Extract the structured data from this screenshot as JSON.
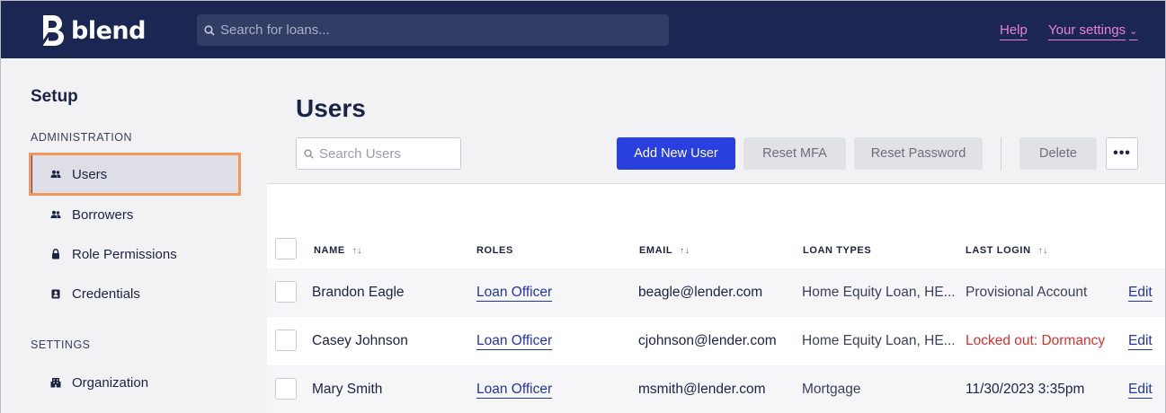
{
  "app": {
    "logo_text": "blend",
    "search_placeholder": "Search for loans...",
    "help_label": "Help",
    "settings_label": "Your settings"
  },
  "sidebar": {
    "title": "Setup",
    "sections": [
      {
        "label": "ADMINISTRATION",
        "items": [
          {
            "label": "Users",
            "icon": "users-icon",
            "active": true
          },
          {
            "label": "Borrowers",
            "icon": "people-icon"
          },
          {
            "label": "Role Permissions",
            "icon": "lock-icon"
          },
          {
            "label": "Credentials",
            "icon": "id-card-icon"
          }
        ]
      },
      {
        "label": "SETTINGS",
        "items": [
          {
            "label": "Organization",
            "icon": "building-icon"
          }
        ]
      }
    ]
  },
  "main": {
    "title": "Users",
    "search_placeholder": "Search Users",
    "buttons": {
      "add": "Add New User",
      "reset_mfa": "Reset MFA",
      "reset_password": "Reset Password",
      "delete": "Delete",
      "more": "•••"
    },
    "table": {
      "headers": {
        "name": "NAME",
        "roles": "ROLES",
        "email": "EMAIL",
        "loan_types": "LOAN TYPES",
        "last_login": "LAST LOGIN"
      },
      "rows": [
        {
          "name": "Brandon Eagle",
          "role": "Loan Officer",
          "email": "beagle@lender.com",
          "loan_types": "Home Equity Loan, HE...",
          "last_login": "Provisional Account",
          "edit": "Edit"
        },
        {
          "name": "Casey Johnson",
          "role": "Loan Officer",
          "email": "cjohnson@lender.com",
          "loan_types": "Home Equity Loan, HE...",
          "last_login": "Locked out: Dormancy",
          "edit": "Edit"
        },
        {
          "name": "Mary Smith",
          "role": "Loan Officer",
          "email": "msmith@lender.com",
          "loan_types": "Mortgage",
          "last_login": "11/30/2023 3:35pm",
          "edit": "Edit"
        }
      ]
    }
  },
  "colors": {
    "topbar": "#1b2653",
    "accent_pink": "#e884d6",
    "primary_button": "#2a3fe0",
    "locked_red": "#d8332f",
    "highlight_outline": "#f4975a"
  }
}
